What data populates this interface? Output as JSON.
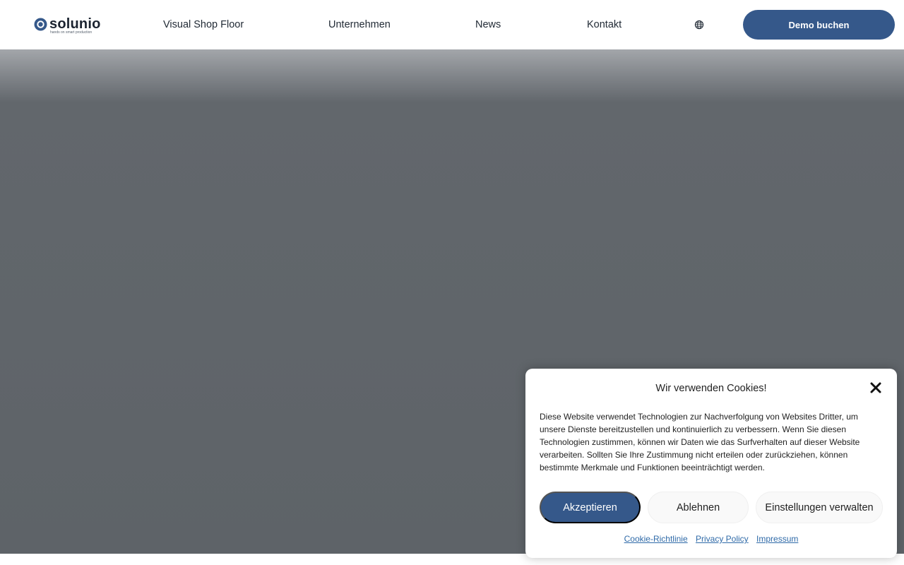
{
  "header": {
    "logo": {
      "name": "solunio",
      "tagline": "hands on smart production"
    },
    "nav": [
      {
        "label": "Visual Shop Floor"
      },
      {
        "label": "Unternehmen"
      },
      {
        "label": "News"
      },
      {
        "label": "Kontakt"
      }
    ],
    "language_icon": "globe-icon",
    "cta_label": "Demo buchen"
  },
  "cookie_banner": {
    "title": "Wir verwenden Cookies!",
    "close_icon": "close-icon",
    "text": "Diese Website verwendet Technologien zur Nachverfolgung von Websites Dritter, um unsere Dienste bereitzustellen und kontinuierlich zu verbessern. Wenn Sie diesen Technologien zustimmen, können wir Daten wie das Surfverhalten auf dieser Website verarbeiten. Sollten Sie Ihre Zustimmung nicht erteilen oder zurückziehen, können bestimmte Merkmale und Funktionen beeinträchtigt werden.",
    "buttons": {
      "accept": "Akzeptieren",
      "deny": "Ablehnen",
      "settings": "Einstellungen verwalten"
    },
    "links": {
      "cookie_policy": "Cookie-Richtlinie",
      "privacy": "Privacy Policy",
      "imprint": "Impressum"
    }
  },
  "colors": {
    "brand": "#35588a",
    "hero_overlay": "#5e6368",
    "link": "#2f6aa8"
  }
}
